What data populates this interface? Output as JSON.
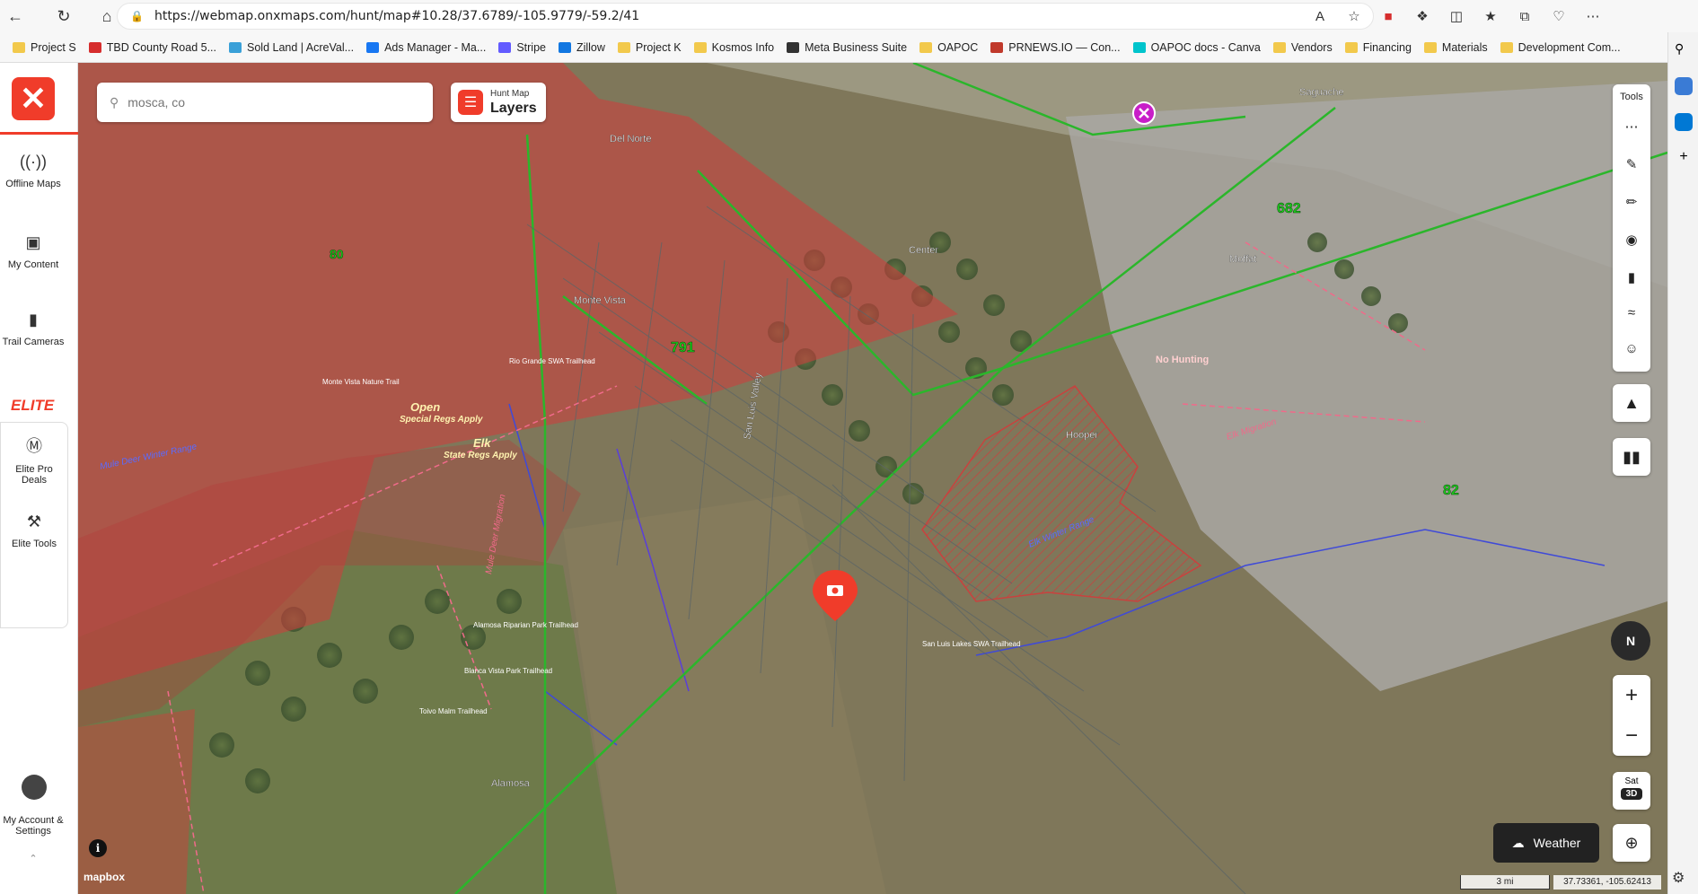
{
  "browser": {
    "url": "https://webmap.onxmaps.com/hunt/map#10.28/37.6789/-105.9779/-59.2/41",
    "bookmarks": [
      {
        "label": "Project S",
        "color": "#f2c94c"
      },
      {
        "label": "TBD County Road 5...",
        "color": "#d62d2d"
      },
      {
        "label": "Sold Land | AcreVal...",
        "color": "#3aa0d8"
      },
      {
        "label": "Ads Manager - Ma...",
        "color": "#1877f2"
      },
      {
        "label": "Stripe",
        "color": "#635bff"
      },
      {
        "label": "Zillow",
        "color": "#1277e1"
      },
      {
        "label": "Project K",
        "color": "#f2c94c"
      },
      {
        "label": "Kosmos Info",
        "color": "#f2c94c"
      },
      {
        "label": "Meta Business Suite",
        "color": "#333333"
      },
      {
        "label": "OAPOC",
        "color": "#f2c94c"
      },
      {
        "label": "PRNEWS.IO — Con...",
        "color": "#c0392b"
      },
      {
        "label": "OAPOC docs - Canva",
        "color": "#00c4cc"
      },
      {
        "label": "Vendors",
        "color": "#f2c94c"
      },
      {
        "label": "Financing",
        "color": "#f2c94c"
      },
      {
        "label": "Materials",
        "color": "#f2c94c"
      },
      {
        "label": "Development Com...",
        "color": "#f2c94c"
      }
    ]
  },
  "sidebar": {
    "items": [
      {
        "label": "Offline Maps",
        "icon": "signal-icon"
      },
      {
        "label": "My Content",
        "icon": "folder-icon"
      },
      {
        "label": "Trail Cameras",
        "icon": "camera-icon"
      }
    ],
    "elite_label": "ELITE",
    "elite_items": [
      {
        "label": "Elite Pro Deals",
        "icon": "dollar-icon"
      },
      {
        "label": "Elite Tools",
        "icon": "tools-icon"
      }
    ],
    "account_label": "My Account & Settings"
  },
  "search": {
    "placeholder": "mosca, co"
  },
  "layers": {
    "small": "Hunt Map",
    "large": "Layers"
  },
  "tools": {
    "label": "Tools"
  },
  "weather": {
    "label": "Weather"
  },
  "sat": {
    "label": "Sat",
    "badge": "3D"
  },
  "scale": {
    "label": "3 mi"
  },
  "coords": {
    "label": "37.73361, -105.62413"
  },
  "attribution": {
    "label": "mapbox"
  },
  "map_labels": {
    "places": [
      "Del Norte",
      "Monte Vista",
      "Center",
      "Saguache",
      "Moffat",
      "Hooper",
      "Alamosa",
      "San Luis Valley"
    ],
    "gmu": [
      "80",
      "791",
      "682",
      "82"
    ],
    "zones": [
      "Open",
      "Special Regs Apply",
      "Elk",
      "State Regs Apply",
      "No Hunting"
    ],
    "ranges": [
      "Mule Deer Winter Range",
      "Elk Winter Range",
      "Mule Deer Migration",
      "Elk Migration"
    ],
    "trailheads": [
      "Alamosa Riparian Park Trailhead",
      "Blanca Vista Park Trailhead",
      "Toivo Malm Trailhead",
      "San Luis Lakes SWA Trailhead",
      "Rio Grande SWA Trailhead",
      "Monte Vista Nature Trail"
    ]
  },
  "colors": {
    "brand": "#f03c2a",
    "unit_fill": "#d23c3c",
    "gmu_line": "#2bb62b"
  }
}
